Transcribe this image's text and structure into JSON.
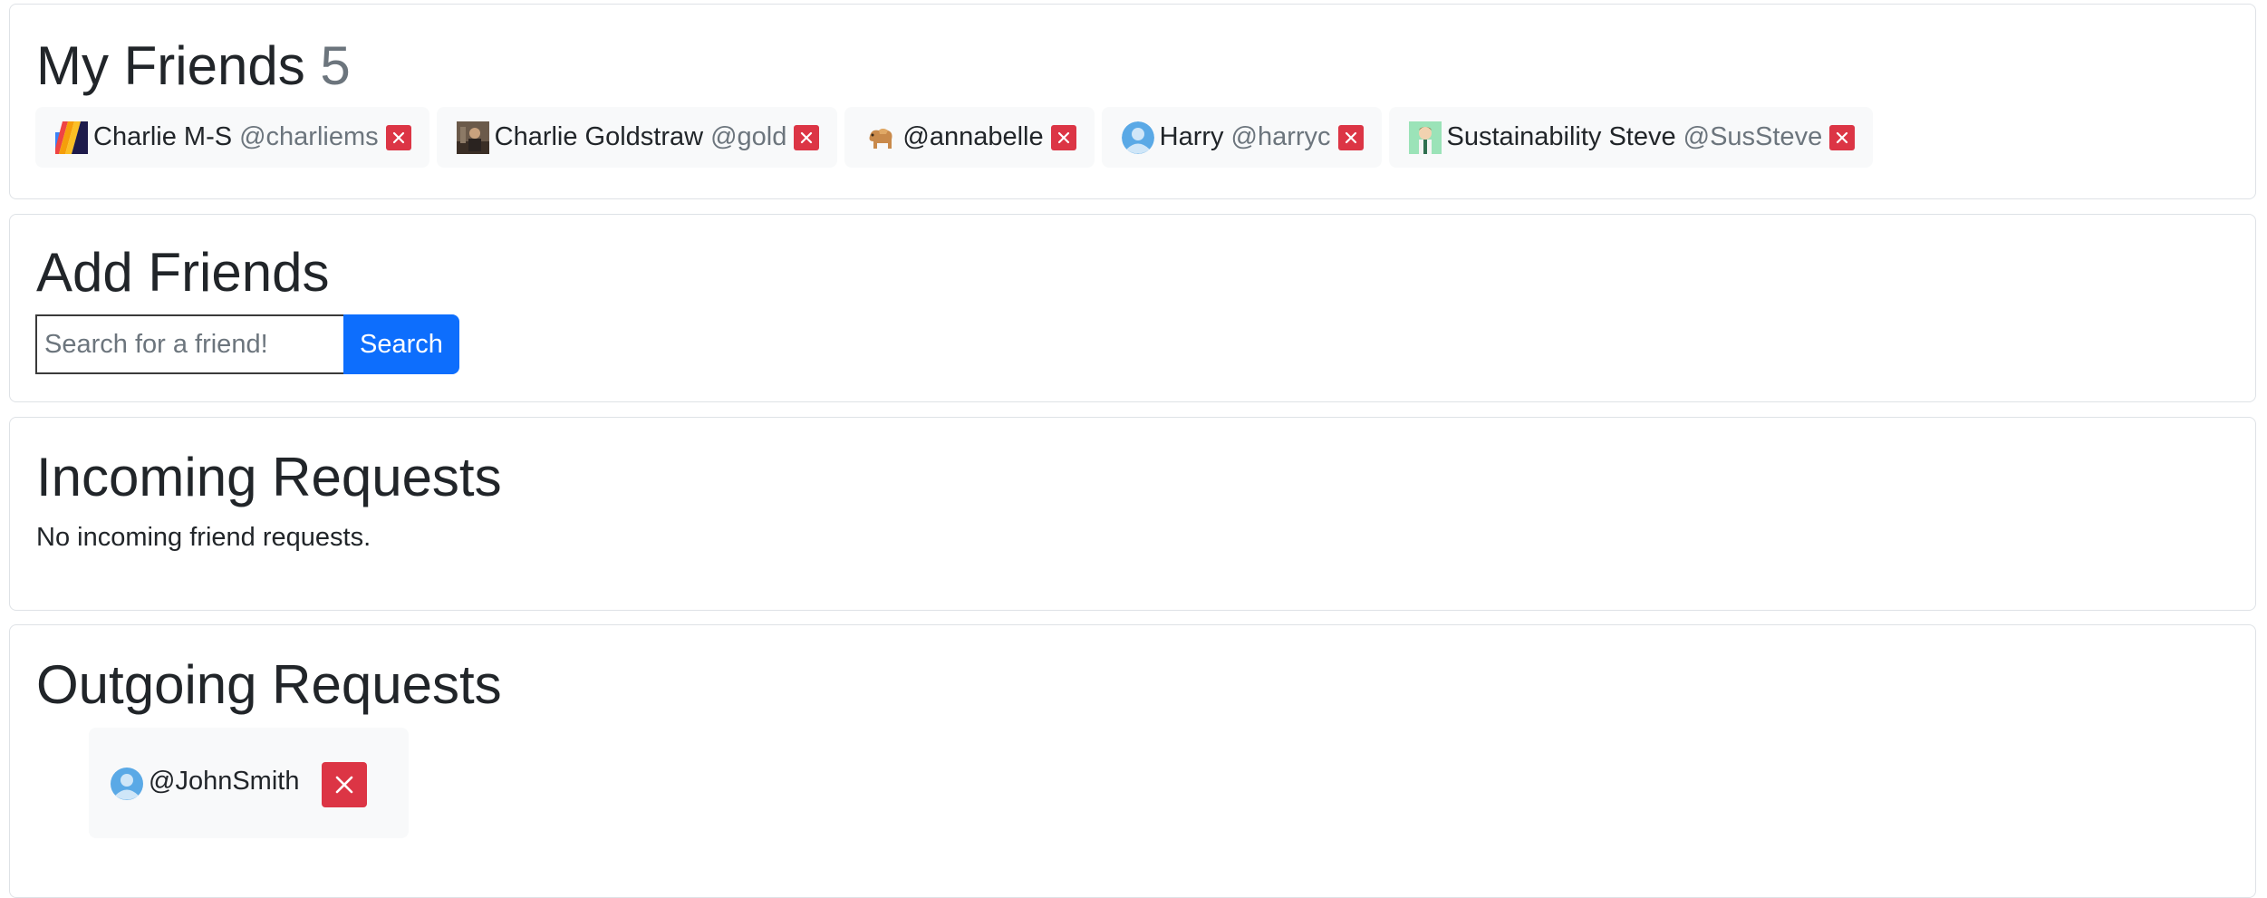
{
  "friends": {
    "title": "My Friends",
    "count": "5",
    "list": [
      {
        "name": "Charlie M-S",
        "handle": "@charliems",
        "avatar": "rainbow-stripes-avatar"
      },
      {
        "name": "Charlie Goldstraw",
        "handle": "@gold",
        "avatar": "photo-avatar"
      },
      {
        "name": "",
        "handle": "@annabelle",
        "avatar": "camel-avatar"
      },
      {
        "name": "Harry",
        "handle": "@harryc",
        "avatar": "default-person-avatar"
      },
      {
        "name": "Sustainability Steve",
        "handle": "@SusSteve",
        "avatar": "cartoon-avatar"
      }
    ]
  },
  "add_friends": {
    "title": "Add Friends",
    "search_placeholder": "Search for a friend!",
    "search_label": "Search"
  },
  "incoming": {
    "title": "Incoming Requests",
    "empty_text": "No incoming friend requests."
  },
  "outgoing": {
    "title": "Outgoing Requests",
    "requests": [
      {
        "handle": "@JohnSmith",
        "avatar": "default-person-avatar"
      }
    ]
  },
  "colors": {
    "primary": "#0d6efd",
    "danger": "#dc3545",
    "muted": "#6c757d",
    "chip_bg": "#f8f9fa",
    "border": "#dee2e6",
    "text": "#212529"
  }
}
